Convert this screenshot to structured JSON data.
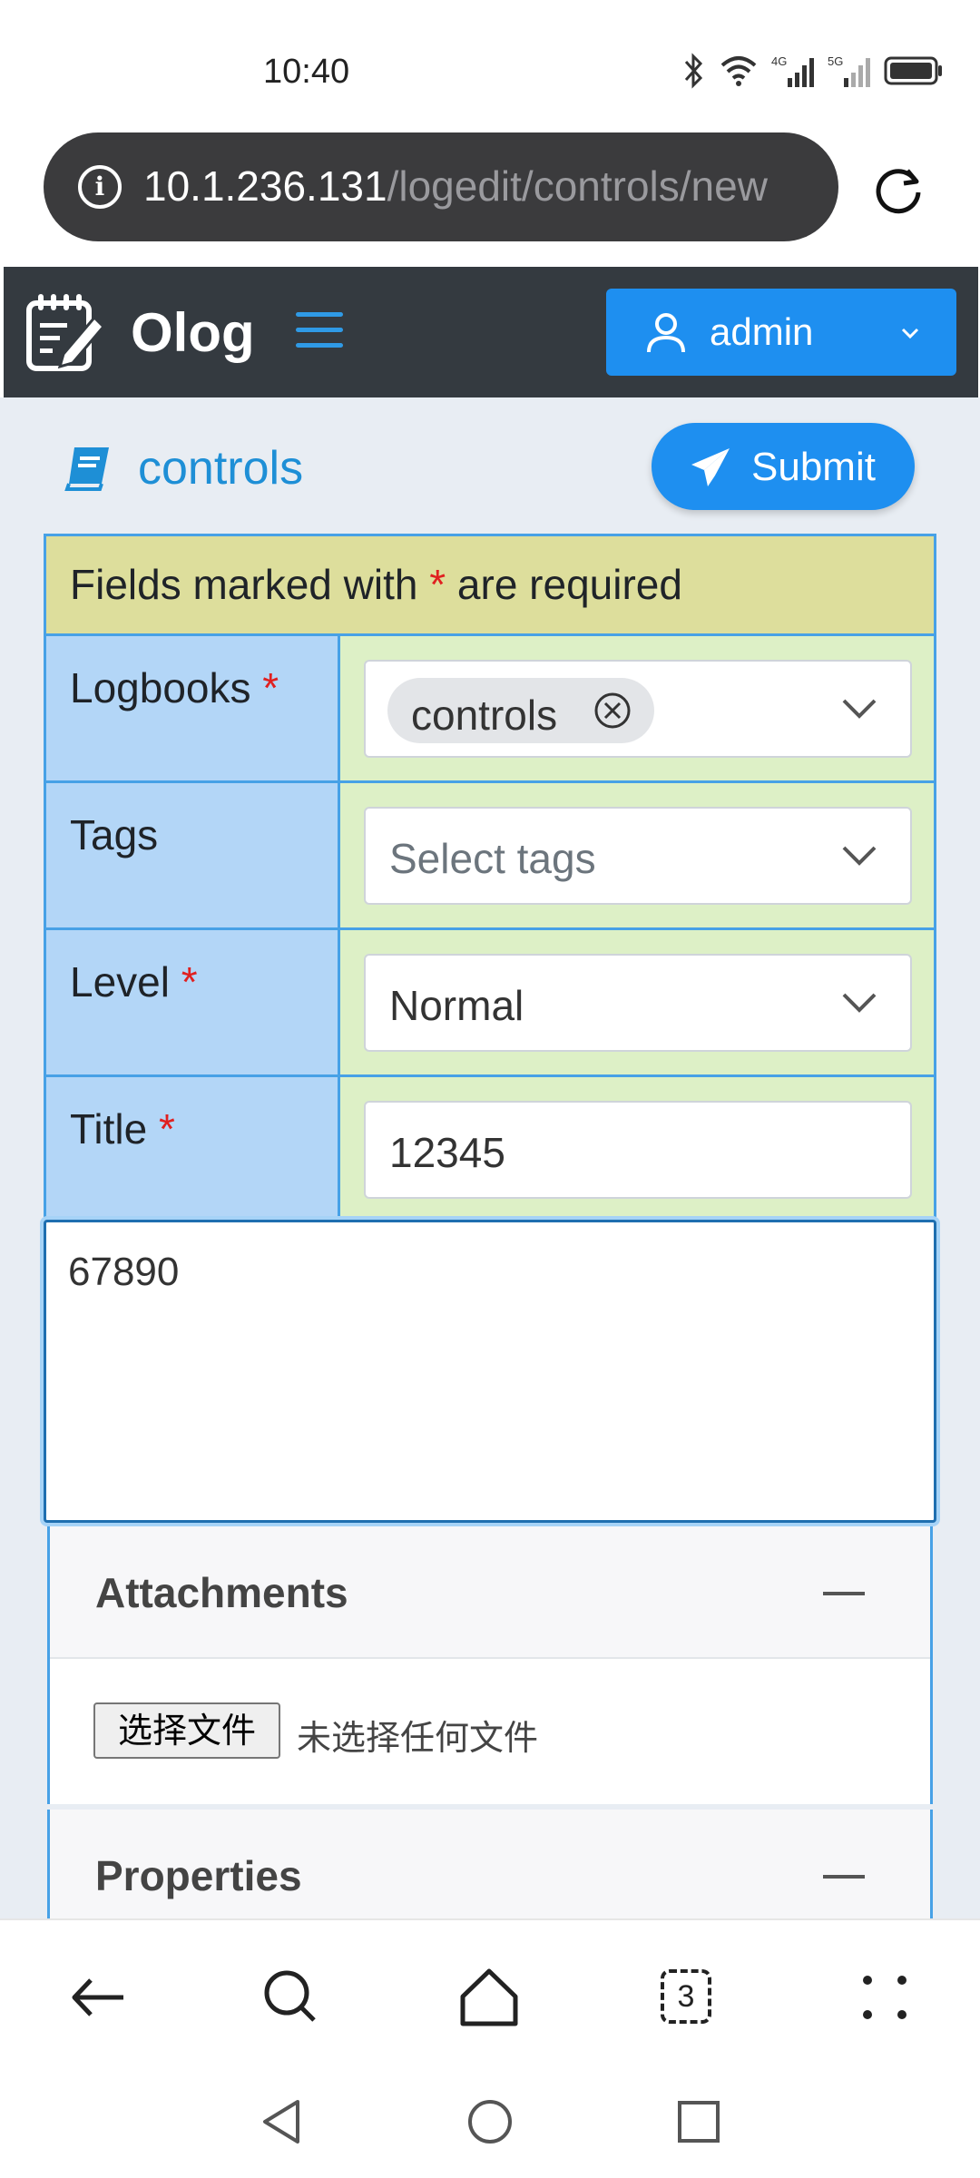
{
  "status_bar": {
    "time": "10:40",
    "network_4g": "4G",
    "network_5g": "5G"
  },
  "browser": {
    "url_host": "10.1.236.131",
    "url_path": "/logedit/controls/new",
    "tab_count": "3"
  },
  "navbar": {
    "brand": "Olog",
    "user": "admin"
  },
  "page": {
    "logbook": "controls",
    "submit_label": "Submit"
  },
  "form": {
    "required_note_prefix": "Fields marked with ",
    "required_star": "*",
    "required_note_suffix": " are required",
    "logbooks": {
      "label": "Logbooks",
      "chips": [
        "controls"
      ]
    },
    "tags": {
      "label": "Tags",
      "placeholder": "Select tags"
    },
    "level": {
      "label": "Level",
      "value": "Normal"
    },
    "title": {
      "label": "Title",
      "value": "12345"
    },
    "body": {
      "value": "67890"
    }
  },
  "attachments": {
    "title": "Attachments",
    "file_button": "选择文件",
    "file_status": "未选择任何文件"
  },
  "properties": {
    "title": "Properties"
  },
  "colors": {
    "navbar": "#343a40",
    "primary": "#1e8ff0",
    "label_bg": "#b3d6f7",
    "value_bg": "#ddf0c6",
    "note_bg": "#ddde9c"
  }
}
